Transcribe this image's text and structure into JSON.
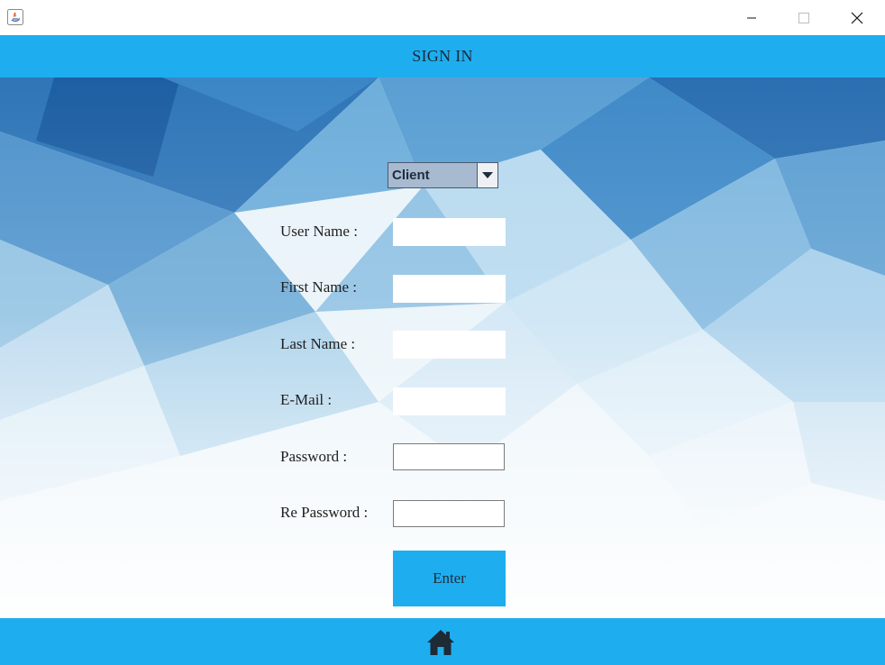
{
  "header": {
    "title": "SIGN IN"
  },
  "icons": {
    "app": "java-app-icon",
    "minimize": "minimize-icon",
    "maximize": "maximize-icon",
    "close": "close-icon",
    "dropdown": "chevron-down-icon",
    "home": "home-icon"
  },
  "form": {
    "role_select": {
      "value": "Client",
      "options": [
        "Client"
      ]
    },
    "fields": {
      "username": {
        "label": "User Name :",
        "value": ""
      },
      "firstname": {
        "label": "First Name :",
        "value": ""
      },
      "lastname": {
        "label": "Last Name :",
        "value": ""
      },
      "email": {
        "label": "E-Mail :",
        "value": ""
      },
      "password": {
        "label": "Password :",
        "value": ""
      },
      "repassword": {
        "label": "Re Password :",
        "value": ""
      }
    },
    "submit_label": "Enter"
  },
  "colors": {
    "accent": "#1eaeef",
    "text": "#1f1f1f",
    "combo_bg": "#a7bad0"
  }
}
